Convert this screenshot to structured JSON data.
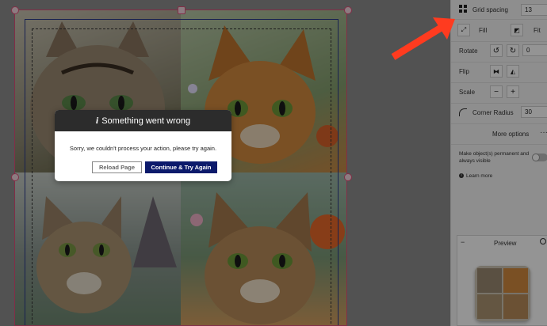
{
  "panel": {
    "grid_spacing_label": "Grid spacing",
    "grid_spacing_value": "13",
    "fill_label": "Fill",
    "fit_label": "Fit",
    "rotate_label": "Rotate",
    "rotate_value": "0",
    "flip_label": "Flip",
    "scale_label": "Scale",
    "scale_minus": "−",
    "scale_plus": "+",
    "corner_radius_label": "Corner Radius",
    "corner_radius_value": "30",
    "more_options_label": "More options",
    "permanent_label": "Make object(s) permanent and always visible",
    "learn_more_label": "Learn more",
    "preview_label": "Preview",
    "preview_collapse": "−"
  },
  "modal": {
    "title": "Something went wrong",
    "title_icon": "i",
    "message": "Sorry, we couldn't process your action, please try again.",
    "reload_label": "Reload Page",
    "continue_label": "Continue & Try Again"
  },
  "colors": {
    "continue_button": "#0c1a6b",
    "selection": "#e0507a",
    "arrow": "#ff3b1f"
  },
  "icons": {
    "grid": "grid-icon",
    "fill": "fill-icon",
    "fit": "fit-icon",
    "rotate_left": "rotate-left-icon",
    "rotate_right": "rotate-right-icon",
    "flip_h": "flip-horizontal-icon",
    "flip_v": "flip-vertical-icon",
    "info": "info-icon",
    "search": "search-icon"
  }
}
